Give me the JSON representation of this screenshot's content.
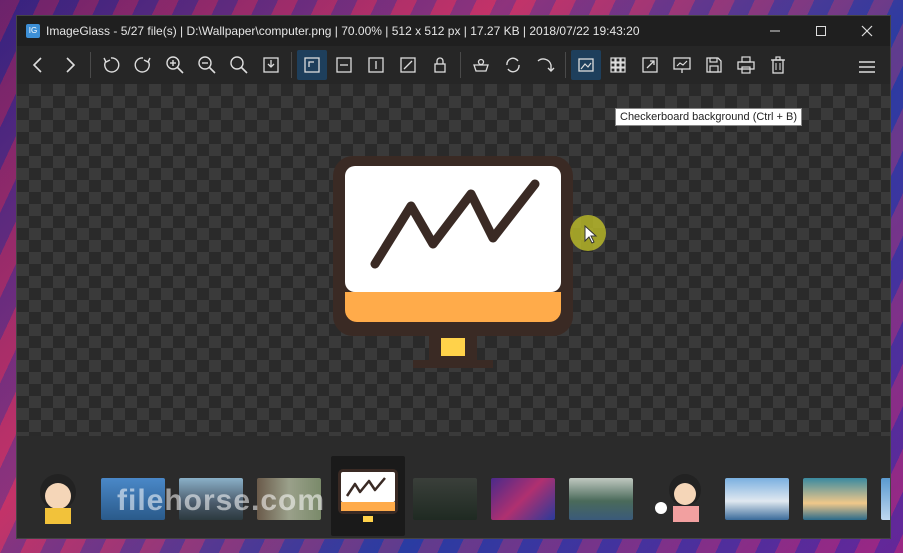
{
  "window": {
    "title": "ImageGlass - 5/27 file(s)  |  D:\\Wallpaper\\computer.png  |  70.00%  |  512 x 512 px  |  17.27 KB  |  2018/07/22 19:43:20",
    "app_icon_glyph": "IG"
  },
  "toolbar": {
    "buttons": [
      {
        "name": "previous-icon"
      },
      {
        "name": "next-icon"
      },
      {
        "name": "rotate-left-icon"
      },
      {
        "name": "rotate-right-icon"
      },
      {
        "name": "zoom-in-icon"
      },
      {
        "name": "zoom-out-icon"
      },
      {
        "name": "zoom-fit-icon"
      },
      {
        "name": "scale-to-fit-icon"
      },
      {
        "name": "actual-size-icon"
      },
      {
        "name": "scale-to-width-icon"
      },
      {
        "name": "scale-to-height-icon"
      },
      {
        "name": "auto-zoom-icon"
      },
      {
        "name": "lock-zoom-icon"
      },
      {
        "name": "open-with-icon"
      },
      {
        "name": "refresh-icon"
      },
      {
        "name": "go-to-icon"
      },
      {
        "name": "checkerboard-icon"
      },
      {
        "name": "thumbnail-bar-icon"
      },
      {
        "name": "fullscreen-icon"
      },
      {
        "name": "slideshow-icon"
      },
      {
        "name": "save-icon"
      },
      {
        "name": "print-icon"
      },
      {
        "name": "delete-icon"
      }
    ],
    "active_button": "checkerboard-icon"
  },
  "tooltip": {
    "text": "Checkerboard background (Ctrl + B)"
  },
  "image": {
    "screen_color": "#ffffff",
    "frame_color": "#3a2a24",
    "base_color": "#ffab4a",
    "stand_color": "#ffd24a",
    "line_color": "#3a2a24"
  },
  "thumbnails": [
    {
      "name": "thumb-character"
    },
    {
      "name": "thumb-ocean"
    },
    {
      "name": "thumb-mountain-road"
    },
    {
      "name": "thumb-rocks"
    },
    {
      "name": "thumb-computer"
    },
    {
      "name": "thumb-forest"
    },
    {
      "name": "thumb-abstract"
    },
    {
      "name": "thumb-lake"
    },
    {
      "name": "thumb-character-girl"
    },
    {
      "name": "thumb-snow-lake"
    },
    {
      "name": "thumb-beach"
    },
    {
      "name": "thumb-partial"
    }
  ],
  "watermark": {
    "text": "filehorse.com"
  }
}
